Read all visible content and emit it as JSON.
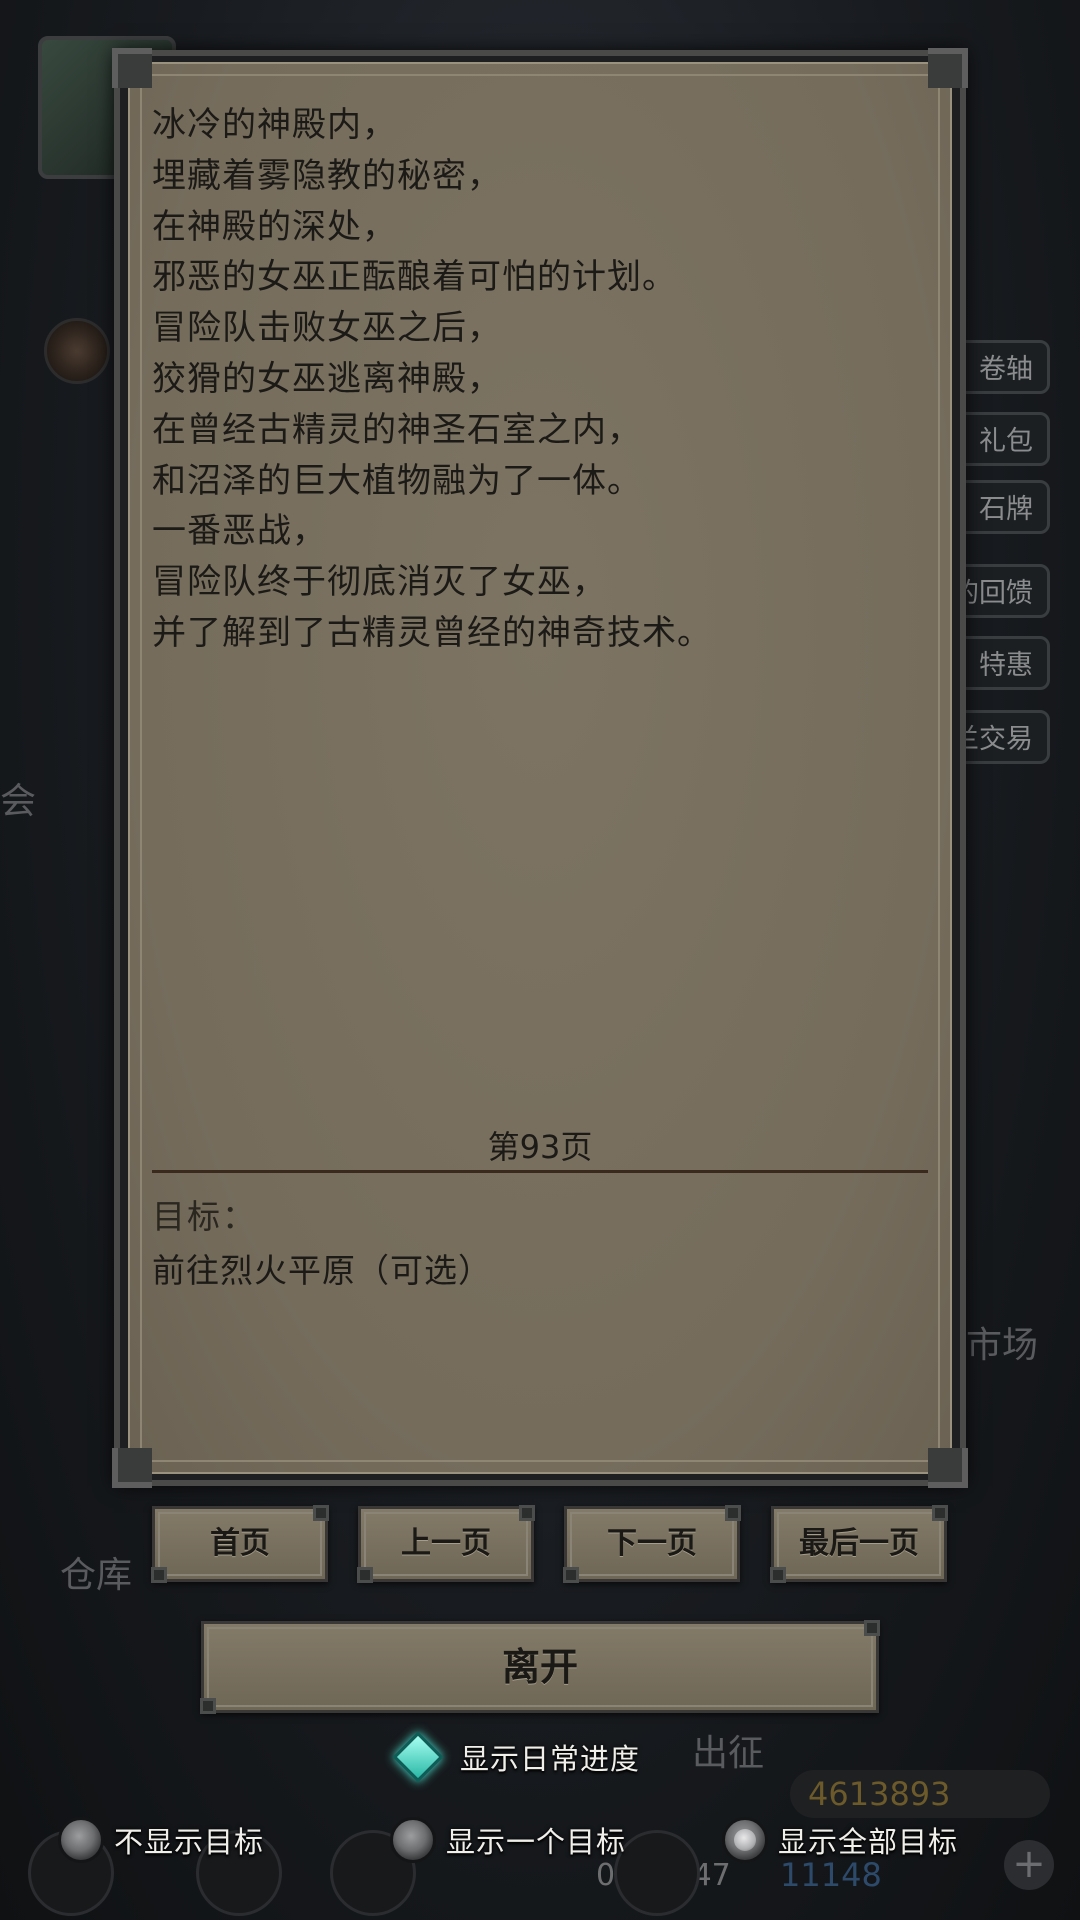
{
  "background": {
    "side_buttons": [
      "卷轴",
      "礼包",
      "石牌",
      "的回馈",
      "特惠",
      "兰交易"
    ],
    "labels": {
      "left_mid": "会",
      "market": "市场",
      "warehouse": "仓库",
      "expedition": "出征"
    },
    "gold": "4613893",
    "gems": "11148",
    "time": "09:18:47",
    "plus": "+"
  },
  "book": {
    "story_lines": [
      "冰冷的神殿内，",
      "埋藏着雾隐教的秘密，",
      "在神殿的深处，",
      "邪恶的女巫正酝酿着可怕的计划。",
      "冒险队击败女巫之后，",
      "狡猾的女巫逃离神殿，",
      "在曾经古精灵的神圣石室之内，",
      "和沼泽的巨大植物融为了一体。",
      "一番恶战，",
      "冒险队终于彻底消灭了女巫，",
      "并了解到了古精灵曾经的神奇技术。"
    ],
    "page_label": "第93页",
    "goal_title": "目标：",
    "goal_text": "前往烈火平原（可选）"
  },
  "nav": {
    "first": "首页",
    "prev": "上一页",
    "next": "下一页",
    "last": "最后一页",
    "exit": "离开"
  },
  "options": {
    "daily_progress": "显示日常进度",
    "radio": [
      {
        "label": "不显示目标",
        "selected": false
      },
      {
        "label": "显示一个目标",
        "selected": false
      },
      {
        "label": "显示全部目标",
        "selected": true
      }
    ]
  },
  "colors": {
    "parchment": "#797060",
    "text": "#1c1a16",
    "accent_diamond": "#4ee0cf"
  }
}
